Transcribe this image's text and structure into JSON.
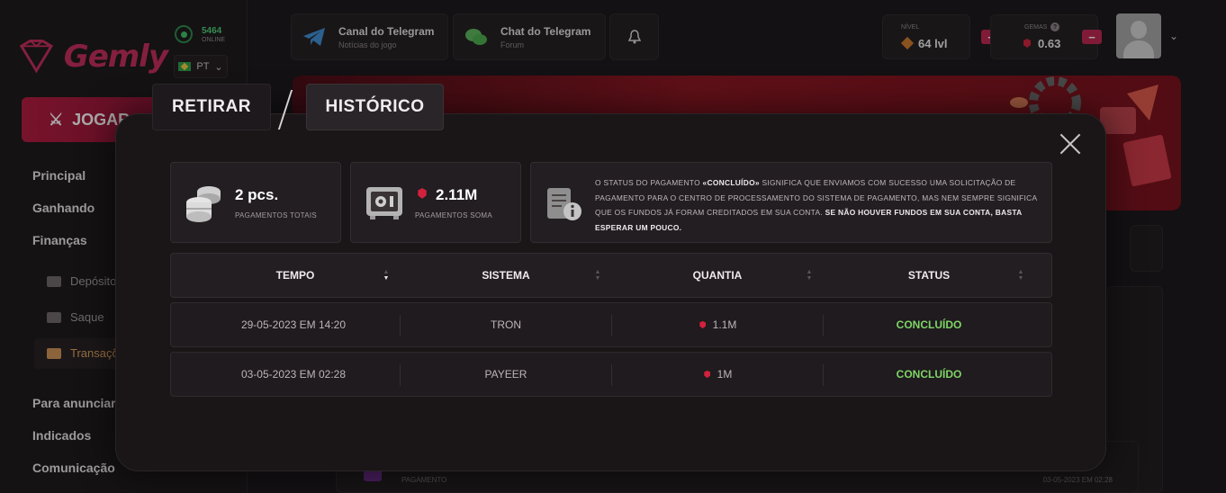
{
  "brand": {
    "logo_text": "Gemly"
  },
  "online": {
    "count": "5464",
    "label": "ONLINE"
  },
  "language": {
    "code": "PT"
  },
  "sidebar": {
    "play_label": "JOGAR",
    "items": [
      {
        "label": "Principal"
      },
      {
        "label": "Ganhando"
      },
      {
        "label": "Finanças"
      },
      {
        "label": "Para anunciar"
      },
      {
        "label": "Indicados"
      },
      {
        "label": "Comunicação"
      }
    ],
    "sub_items": [
      {
        "label": "Depósito"
      },
      {
        "label": "Saque"
      },
      {
        "label": "Transações"
      }
    ]
  },
  "header": {
    "telegram_channel": {
      "title": "Canal do Telegram",
      "subtitle": "Notícias do jogo"
    },
    "telegram_chat": {
      "title": "Chat do Telegram",
      "subtitle": "Forum"
    },
    "level": {
      "label": "NÍVEL",
      "value": "64 lvl"
    },
    "gems": {
      "label": "GEMAS",
      "value": "0.63",
      "help": "?"
    },
    "plus": "+",
    "minus": "−"
  },
  "modal": {
    "tabs": [
      {
        "label": "RETIRAR"
      },
      {
        "label": "HISTÓRICO"
      }
    ],
    "stats": {
      "total_payments": {
        "value": "2 pcs.",
        "label": "PAGAMENTOS TOTAIS"
      },
      "payments_sum": {
        "value": "2.11M",
        "label": "PAGAMENTOS SOMA"
      }
    },
    "info": {
      "text_1": "O STATUS DO PAGAMENTO ",
      "bold_1": "«CONCLUÍDO»",
      "text_2": " SIGNIFICA QUE ENVIAMOS COM SUCESSO UMA SOLICITAÇÃO DE PAGAMENTO PARA O CENTRO DE PROCESSAMENTO DO SISTEMA DE PAGAMENTO, MAS NEM SEMPRE SIGNIFICA QUE OS FUNDOS JÁ FORAM CREDITADOS EM SUA CONTA. ",
      "bold_2": "SE NÃO HOUVER FUNDOS EM SUA CONTA, BASTA ESPERAR UM POUCO."
    },
    "table": {
      "columns": [
        "TEMPO",
        "SISTEMA",
        "QUANTIA",
        "STATUS"
      ],
      "rows": [
        {
          "time": "29-05-2023 EM 14:20",
          "system": "TRON",
          "amount": "1.1M",
          "status": "CONCLUÍDO"
        },
        {
          "time": "03-05-2023 EM 02:28",
          "system": "PAYEER",
          "amount": "1M",
          "status": "CONCLUÍDO"
        }
      ]
    }
  },
  "background": {
    "row_label": "PAGAMENTO",
    "row_date": "03-05-2023 EM 02:28"
  },
  "colors": {
    "accent": "#c02551",
    "status_done": "#7fd467",
    "online": "#4fd07a"
  }
}
